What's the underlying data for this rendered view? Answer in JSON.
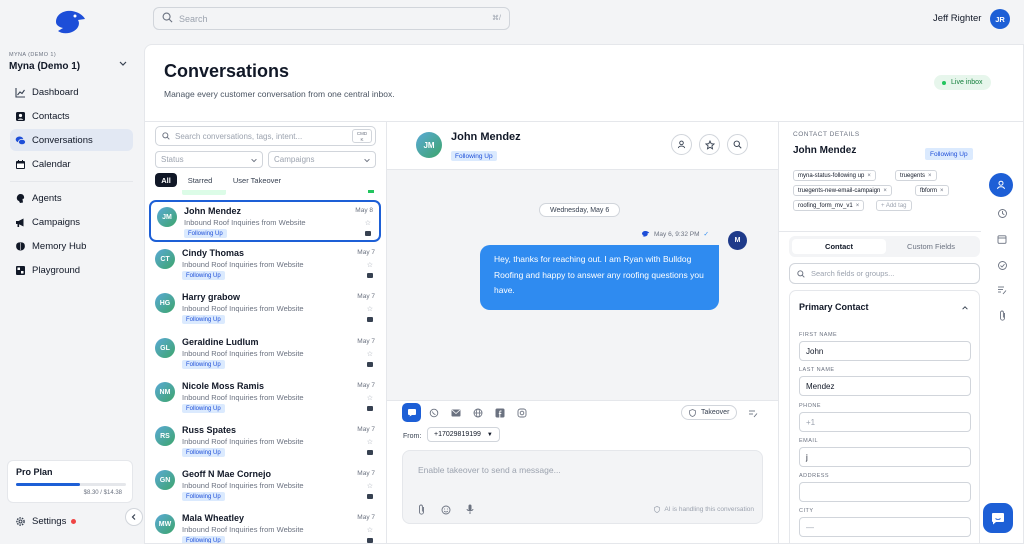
{
  "search": {
    "placeholder": "Search",
    "shortcut": "⌘/"
  },
  "user": {
    "name": "Jeff Righter",
    "initials": "JR"
  },
  "workspace": {
    "small": "MYNA (DEMO 1)",
    "name": "Myna (Demo 1)"
  },
  "nav": {
    "dashboard": "Dashboard",
    "contacts": "Contacts",
    "conversations": "Conversations",
    "calendar": "Calendar",
    "agents": "Agents",
    "campaigns": "Campaigns",
    "memory_hub": "Memory Hub",
    "playground": "Playground"
  },
  "plan": {
    "title": "Pro Plan",
    "usage": "$8.30 / $14.38",
    "fraction": 0.58
  },
  "settings": {
    "label": "Settings"
  },
  "page": {
    "title": "Conversations",
    "subtitle": "Manage every customer conversation from one central inbox.",
    "live": "Live inbox"
  },
  "list": {
    "search_placeholder": "Search conversations, tags, intent...",
    "cmd_top": "CMD",
    "cmd_bottom": "K",
    "status_filter": "Status",
    "campaigns_filter": "Campaigns",
    "tabs": [
      "All",
      "Starred",
      "User Takeover"
    ],
    "conversations": [
      {
        "initials": "JM",
        "name": "John Mendez",
        "date": "May 8",
        "preview": "Inbound Roof Inquiries from Website",
        "tag": "Following Up"
      },
      {
        "initials": "CT",
        "name": "Cindy Thomas",
        "date": "May 7",
        "preview": "Inbound Roof Inquiries from Website",
        "tag": "Following Up"
      },
      {
        "initials": "HG",
        "name": "Harry grabow",
        "date": "May 7",
        "preview": "Inbound Roof Inquiries from Website",
        "tag": "Following Up"
      },
      {
        "initials": "GL",
        "name": "Geraldine Ludlum",
        "date": "May 7",
        "preview": "Inbound Roof Inquiries from Website",
        "tag": "Following Up"
      },
      {
        "initials": "NM",
        "name": "Nicole Moss Ramis",
        "date": "May 7",
        "preview": "Inbound Roof Inquiries from Website",
        "tag": "Following Up"
      },
      {
        "initials": "RS",
        "name": "Russ Spates",
        "date": "May 7",
        "preview": "Inbound Roof Inquiries from Website",
        "tag": "Following Up"
      },
      {
        "initials": "GN",
        "name": "Geoff N Mae Cornejo",
        "date": "May 7",
        "preview": "Inbound Roof Inquiries from Website",
        "tag": "Following Up"
      },
      {
        "initials": "MW",
        "name": "Mala Wheatley",
        "date": "May 7",
        "preview": "Inbound Roof Inquiries from Website",
        "tag": "Following Up"
      }
    ]
  },
  "chat": {
    "initials": "JM",
    "name": "John Mendez",
    "status": "Following Up",
    "date_divider": "Wednesday, May 6",
    "message_time": "May 6, 9:32 PM",
    "message": "Hey, thanks for reaching out. I am Ryan with Bulldog Roofing and happy to answer any roofing questions you have.",
    "agent_initials": "M",
    "takeover": "Takeover",
    "from_label": "From:",
    "from_number": "+17029819199",
    "compose_placeholder": "Enable takeover to send a message...",
    "ai_note": "AI is handling this conversation"
  },
  "details": {
    "section_label": "CONTACT DETAILS",
    "name": "John Mendez",
    "status": "Following Up",
    "tags": [
      "myna-status-following up",
      "truegents",
      "truegents-new-email-campaign",
      "fbform",
      "roofing_form_mv_v1"
    ],
    "add_tag": "+ Add tag",
    "tabs": [
      "Contact",
      "Custom Fields"
    ],
    "field_search": "Search fields or groups...",
    "card_title": "Primary Contact",
    "fields": [
      {
        "label": "FIRST NAME",
        "value": "John"
      },
      {
        "label": "LAST NAME",
        "value": "Mendez"
      },
      {
        "label": "PHONE",
        "value": "+1"
      },
      {
        "label": "EMAIL",
        "value": "j"
      },
      {
        "label": "ADDRESS",
        "value": ""
      },
      {
        "label": "CITY",
        "value": "—"
      }
    ]
  },
  "colors": {
    "accent": "#1d5fd6",
    "bubble": "#2f8bf0",
    "live": "#22c55e",
    "tag_bg": "#dbeafe"
  }
}
